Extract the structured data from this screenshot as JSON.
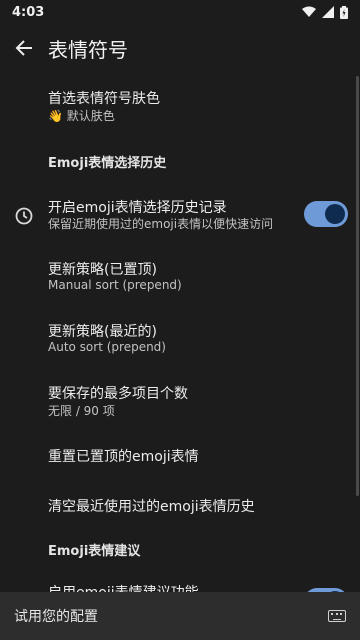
{
  "status_bar": {
    "time": "4:03"
  },
  "app_bar": {
    "title": "表情符号"
  },
  "settings": {
    "skin_tone": {
      "title": "首选表情符号肤色",
      "summary_emoji": "👋",
      "summary": "默认肤色"
    },
    "history_header": "Emoji表情选择历史",
    "history_toggle": {
      "title": "开启emoji表情选择历史记录",
      "summary": "保留近期使用过的emoji表情以便快速访问",
      "enabled": true
    },
    "update_pinned": {
      "title": "更新策略(已置顶)",
      "summary": "Manual sort (prepend)"
    },
    "update_recent": {
      "title": "更新策略(最近的)",
      "summary": "Auto sort (prepend)"
    },
    "max_items": {
      "title": "要保存的最多项目个数",
      "summary": "无限 / 90 项"
    },
    "reset_pinned": {
      "title": "重置已置顶的emoji表情"
    },
    "clear_recent": {
      "title": "清空最近使用过的emoji表情历史"
    },
    "suggestion_header": "Emoji表情建议",
    "suggestion_toggle": {
      "title": "启用emoji表情建议功能",
      "enabled": true
    }
  },
  "bottom_bar": {
    "placeholder": "试用您的配置",
    "icon": "keyboard-icon"
  },
  "colors": {
    "background": "#1c1c1c",
    "accent": "#6e9bd8",
    "bottom_bar": "#2d2d2d"
  }
}
